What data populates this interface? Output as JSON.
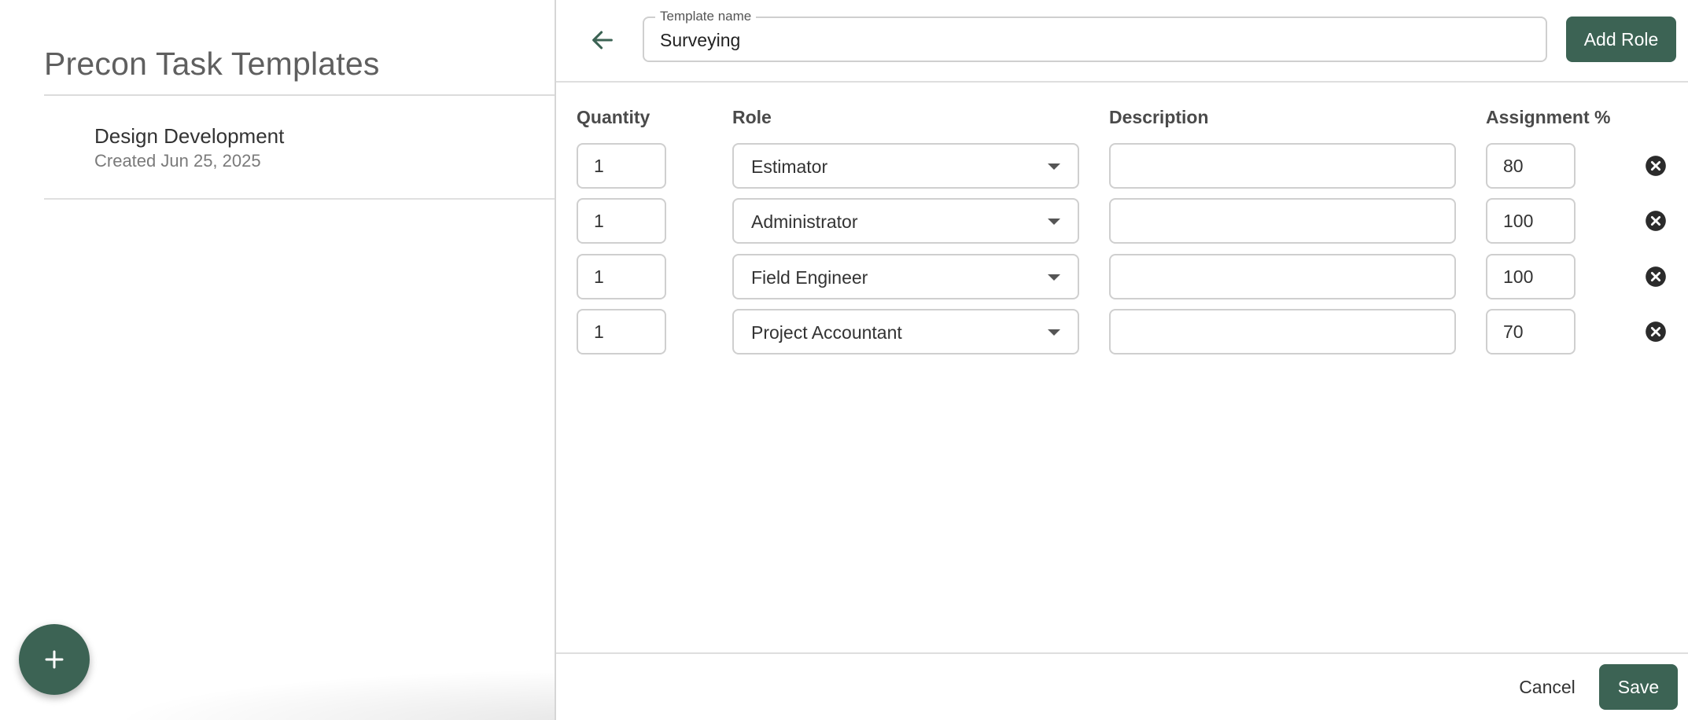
{
  "left": {
    "title": "Precon Task Templates",
    "templates": [
      {
        "name": "Design Development",
        "created": "Created Jun 25, 2025"
      }
    ]
  },
  "editor": {
    "template_name_label": "Template name",
    "template_name_value": "Surveying",
    "add_role_label": "Add Role",
    "columns": {
      "quantity": "Quantity",
      "role": "Role",
      "description": "Description",
      "assignment": "Assignment %"
    },
    "rows": [
      {
        "quantity": "1",
        "role": "Estimator",
        "description": "",
        "assignment": "80"
      },
      {
        "quantity": "1",
        "role": "Administrator",
        "description": "",
        "assignment": "100"
      },
      {
        "quantity": "1",
        "role": "Field Engineer",
        "description": "",
        "assignment": "100"
      },
      {
        "quantity": "1",
        "role": "Project Accountant",
        "description": "",
        "assignment": "70"
      }
    ],
    "cancel_label": "Cancel",
    "save_label": "Save"
  },
  "colors": {
    "primary": "#3c6354",
    "border": "#cfcfcf"
  },
  "icons": {
    "back": "arrow-left-icon",
    "fab": "plus-icon",
    "remove": "close-circle-icon",
    "dropdown": "caret-down-icon"
  }
}
